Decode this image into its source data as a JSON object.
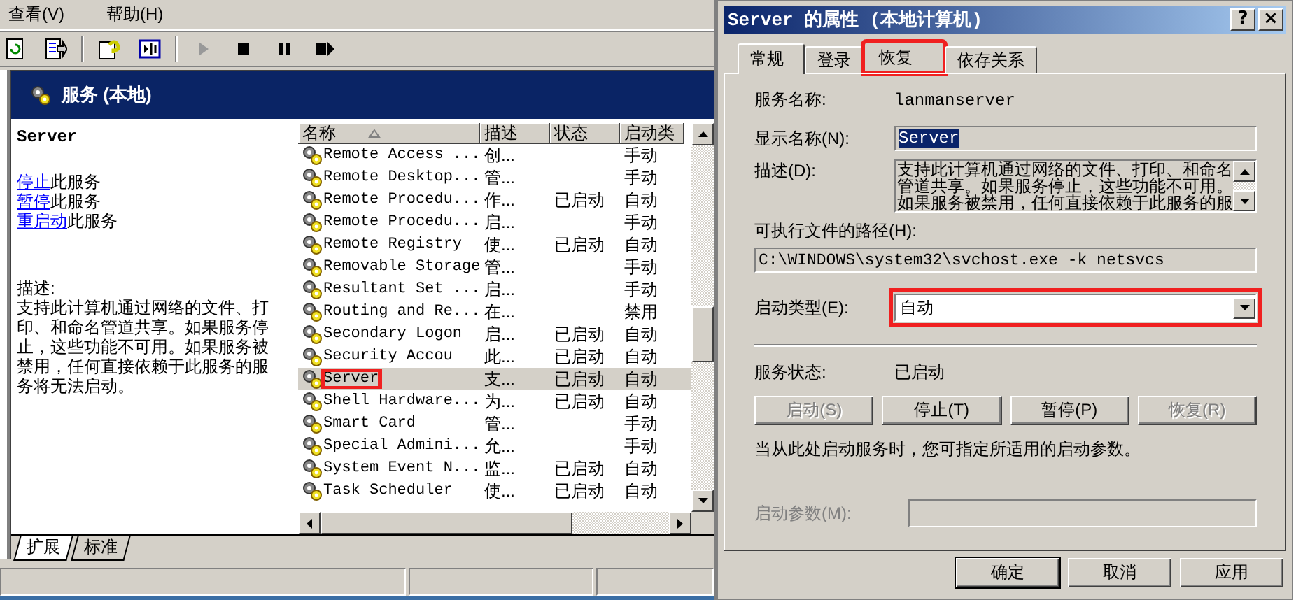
{
  "menu_bar": [
    {
      "label": "查看(V)"
    },
    {
      "label": "帮助(H)"
    }
  ],
  "toolbar": [
    {
      "kind": "refresh",
      "disabled": false
    },
    {
      "kind": "export",
      "disabled": false
    },
    {
      "kind": "help",
      "disabled": false
    },
    {
      "kind": "view",
      "disabled": false
    },
    {
      "kind": "play",
      "disabled": true
    },
    {
      "kind": "stop",
      "disabled": false
    },
    {
      "kind": "pause",
      "disabled": false
    },
    {
      "kind": "restart",
      "disabled": false
    }
  ],
  "header": {
    "title": "服务 (本地)"
  },
  "details": {
    "title": "Server",
    "actions": [
      {
        "link": "停止",
        "text": "此服务"
      },
      {
        "link": "暂停",
        "text": "此服务"
      },
      {
        "link": "重启动",
        "text": "此服务"
      }
    ],
    "description_label": "描述:",
    "description": "支持此计算机通过网络的文件、打印、和命名管道共享。如果服务停止，这些功能不可用。如果服务被禁用，任何直接依赖于此服务的服务将无法启动。"
  },
  "list": {
    "columns": [
      {
        "label": "名称",
        "sorted": true
      },
      {
        "label": "描述",
        "sorted": false
      },
      {
        "label": "状态",
        "sorted": false
      },
      {
        "label": "启动类",
        "sorted": false
      }
    ],
    "rows": [
      {
        "name": "Remote Access ...",
        "description": "创...",
        "status": "",
        "startup": "手动",
        "selected": false,
        "highlighted": false
      },
      {
        "name": "Remote Desktop...",
        "description": "管...",
        "status": "",
        "startup": "手动",
        "selected": false,
        "highlighted": false
      },
      {
        "name": "Remote Procedu...",
        "description": "作...",
        "status": "已启动",
        "startup": "自动",
        "selected": false,
        "highlighted": false
      },
      {
        "name": "Remote Procedu...",
        "description": "启...",
        "status": "",
        "startup": "手动",
        "selected": false,
        "highlighted": false
      },
      {
        "name": "Remote Registry",
        "description": "使...",
        "status": "已启动",
        "startup": "自动",
        "selected": false,
        "highlighted": false
      },
      {
        "name": "Removable Storage",
        "description": "管...",
        "status": "",
        "startup": "手动",
        "selected": false,
        "highlighted": false
      },
      {
        "name": "Resultant Set ...",
        "description": "启...",
        "status": "",
        "startup": "手动",
        "selected": false,
        "highlighted": false
      },
      {
        "name": "Routing and Re...",
        "description": "在...",
        "status": "",
        "startup": "禁用",
        "selected": false,
        "highlighted": false
      },
      {
        "name": "Secondary Logon",
        "description": "启...",
        "status": "已启动",
        "startup": "自动",
        "selected": false,
        "highlighted": false
      },
      {
        "name": "Security Accou",
        "description": "此...",
        "status": "已启动",
        "startup": "自动",
        "selected": false,
        "highlighted": false
      },
      {
        "name": "Server",
        "description": "支...",
        "status": "已启动",
        "startup": "自动",
        "selected": true,
        "highlighted": true
      },
      {
        "name": "Shell Hardware...",
        "description": "为...",
        "status": "已启动",
        "startup": "自动",
        "selected": false,
        "highlighted": false
      },
      {
        "name": "Smart Card",
        "description": "管...",
        "status": "",
        "startup": "手动",
        "selected": false,
        "highlighted": false
      },
      {
        "name": "Special Admini...",
        "description": "允...",
        "status": "",
        "startup": "手动",
        "selected": false,
        "highlighted": false
      },
      {
        "name": "System Event N...",
        "description": "监...",
        "status": "已启动",
        "startup": "自动",
        "selected": false,
        "highlighted": false
      },
      {
        "name": "Task Scheduler",
        "description": "使...",
        "status": "已启动",
        "startup": "自动",
        "selected": false,
        "highlighted": false
      }
    ]
  },
  "bottom_tabs": [
    {
      "label": "扩展",
      "selected": true
    },
    {
      "label": "标准",
      "selected": false
    }
  ],
  "dialog": {
    "title": "Server 的属性 (本地计算机)",
    "title_buttons": [
      "?",
      "×"
    ],
    "tabs": [
      {
        "label": "常规",
        "selected": true,
        "highlighted": false
      },
      {
        "label": "登录",
        "selected": false,
        "highlighted": false
      },
      {
        "label": "恢复",
        "selected": false,
        "highlighted": true
      },
      {
        "label": "依存关系",
        "selected": false,
        "highlighted": false
      }
    ],
    "service_name": {
      "label": "服务名称:",
      "value": "lanmanserver"
    },
    "display_name": {
      "label": "显示名称(N):",
      "value": "Server",
      "value_selected": true
    },
    "description": {
      "label": "描述(D):",
      "lines": [
        "支持此计算机通过网络的文件、打印、和命名",
        "管道共享。如果服务停止，这些功能不可用。",
        "如果服务被禁用，任何直接依赖于此服务的服"
      ]
    },
    "path": {
      "label": "可执行文件的路径(H):",
      "value": "C:\\WINDOWS\\system32\\svchost.exe -k netsvcs"
    },
    "startup_type": {
      "label": "启动类型(E):",
      "value": "自动",
      "highlighted": true
    },
    "status": {
      "label": "服务状态:",
      "value": "已启动"
    },
    "service_buttons": [
      {
        "label": "启动(S)",
        "disabled": true
      },
      {
        "label": "停止(T)",
        "disabled": false
      },
      {
        "label": "暂停(P)",
        "disabled": false
      },
      {
        "label": "恢复(R)",
        "disabled": true
      }
    ],
    "hint": "当从此处启动服务时，您可指定所适用的启动参数。",
    "start_params": {
      "label": "启动参数(M):",
      "disabled": true
    },
    "buttons": [
      {
        "label": "确定",
        "default": true
      },
      {
        "label": "取消",
        "default": false
      },
      {
        "label": "应用",
        "default": false
      }
    ]
  }
}
